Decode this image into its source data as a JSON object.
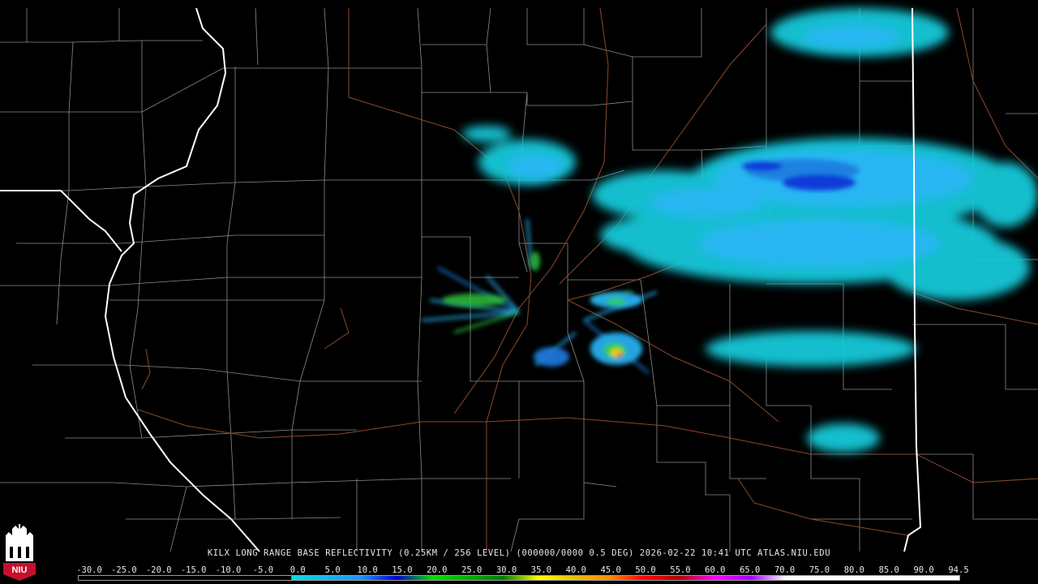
{
  "caption": {
    "text": "KILX LONG RANGE BASE REFLECTIVITY (0.25KM / 256 LEVEL) (000000/0000 0.5 DEG) 2026-02-22 10:41 UTC  ATLAS.NIU.EDU"
  },
  "logo": {
    "text": "NIU",
    "colors": {
      "red": "#c8102e",
      "white": "#ffffff"
    }
  },
  "scale": {
    "labels": [
      "-30.0",
      "-25.0",
      "-20.0",
      "-15.0",
      "-10.0",
      "-5.0",
      "0.0",
      "5.0",
      "10.0",
      "15.0",
      "20.0",
      "25.0",
      "30.0",
      "35.0",
      "40.0",
      "45.0",
      "50.0",
      "55.0",
      "60.0",
      "65.0",
      "70.0",
      "75.0",
      "80.0",
      "85.0",
      "90.0",
      "94.5"
    ],
    "unit_range": [
      -30.0,
      94.5
    ],
    "stops": [
      {
        "dbz": -30,
        "color": "#000000"
      },
      {
        "dbz": 0,
        "color": "#000000"
      },
      {
        "dbz": 0.1,
        "color": "#08dcdc"
      },
      {
        "dbz": 10,
        "color": "#1e90ff"
      },
      {
        "dbz": 15,
        "color": "#0000d0"
      },
      {
        "dbz": 20,
        "color": "#00e000"
      },
      {
        "dbz": 30,
        "color": "#008000"
      },
      {
        "dbz": 35,
        "color": "#ffff00"
      },
      {
        "dbz": 40,
        "color": "#e8c000"
      },
      {
        "dbz": 45,
        "color": "#ff8c00"
      },
      {
        "dbz": 50,
        "color": "#ff0000"
      },
      {
        "dbz": 55,
        "color": "#b00000"
      },
      {
        "dbz": 60,
        "color": "#ff00ff"
      },
      {
        "dbz": 65,
        "color": "#a000ff"
      },
      {
        "dbz": 70,
        "color": "#ffffff"
      },
      {
        "dbz": 94.5,
        "color": "#ffffff"
      }
    ]
  },
  "map": {
    "background": "#000000",
    "county_line_color": "#8c8c8c",
    "state_line_color": "#ffffff",
    "highway_color": "#8b4a2b",
    "echo_colors": [
      "#19c9d9",
      "#29b6f6",
      "#1e7be0",
      "#0a2fd6",
      "#2ecc40",
      "#f5d000",
      "#ff8a00",
      "#e41a1c"
    ]
  }
}
